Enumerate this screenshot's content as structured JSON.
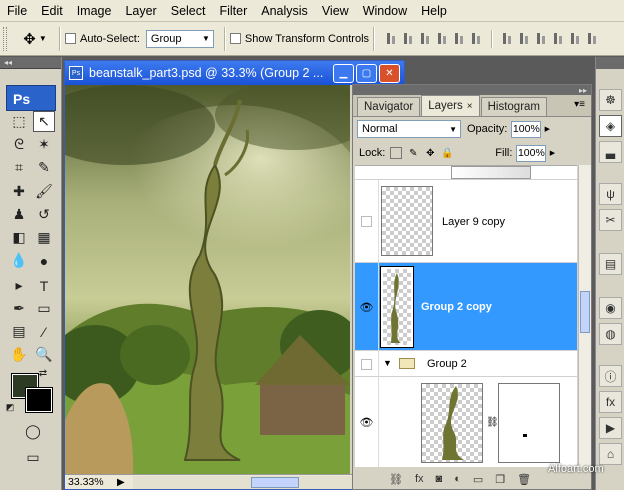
{
  "menubar": [
    "File",
    "Edit",
    "Image",
    "Layer",
    "Select",
    "Filter",
    "Analysis",
    "View",
    "Window",
    "Help"
  ],
  "options": {
    "auto_select_label": "Auto-Select:",
    "auto_select_value": "Group",
    "show_transform_label": "Show Transform Controls",
    "move_icon": "move-tool-icon"
  },
  "toolbox": {
    "logo": "Ps",
    "fg_color": "#2d3a24",
    "bg_color": "#000000"
  },
  "document": {
    "title": "beanstalk_part3.psd @ 33.3% (Group 2 ...",
    "zoom": "33.33%"
  },
  "panel": {
    "tabs": [
      "Navigator",
      "Layers",
      "Histogram"
    ],
    "active_tab": "Layers",
    "blend_mode": "Normal",
    "opacity_label": "Opacity:",
    "opacity_value": "100%",
    "lock_label": "Lock:",
    "fill_label": "Fill:",
    "fill_value": "100%",
    "layers": [
      {
        "name": "Layer 9 copy",
        "visible": false,
        "selected": false
      },
      {
        "name": "Group 2 copy",
        "visible": true,
        "selected": true
      },
      {
        "name": "Group 2",
        "visible": false,
        "selected": false,
        "type": "group",
        "expanded": true
      },
      {
        "name": "",
        "visible": true,
        "selected": false,
        "has_mask": true
      }
    ]
  },
  "watermark": "Alfoart.com",
  "colors": {
    "selection_blue": "#3399ff",
    "title_blue": "#2b63d8",
    "chrome": "#ece9d8"
  }
}
